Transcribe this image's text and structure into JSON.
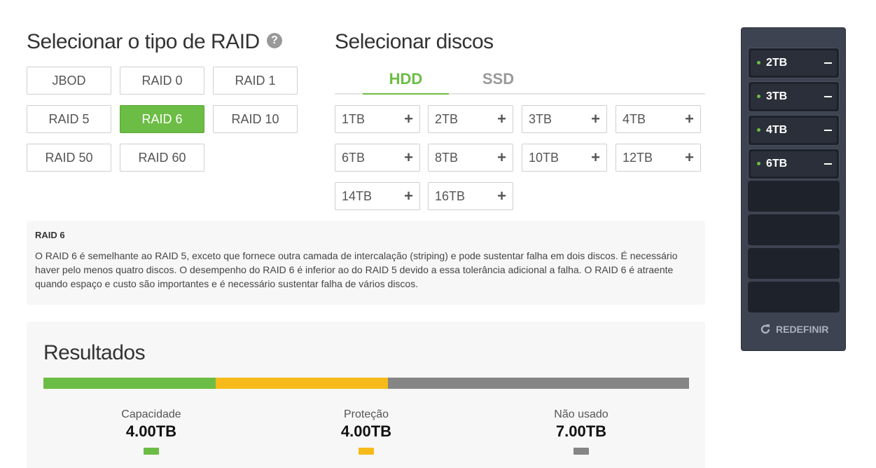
{
  "raid_section": {
    "title": "Selecionar o tipo de RAID",
    "help_glyph": "?",
    "types": [
      {
        "label": "JBOD",
        "active": false
      },
      {
        "label": "RAID 0",
        "active": false
      },
      {
        "label": "RAID 1",
        "active": false
      },
      {
        "label": "RAID 5",
        "active": false
      },
      {
        "label": "RAID 6",
        "active": true
      },
      {
        "label": "RAID 10",
        "active": false
      },
      {
        "label": "RAID 50",
        "active": false
      },
      {
        "label": "RAID 60",
        "active": false
      }
    ]
  },
  "disk_section": {
    "title": "Selecionar discos",
    "tabs": [
      {
        "label": "HDD",
        "active": true
      },
      {
        "label": "SSD",
        "active": false
      }
    ],
    "disks": [
      "1TB",
      "2TB",
      "3TB",
      "4TB",
      "6TB",
      "8TB",
      "10TB",
      "12TB",
      "14TB",
      "16TB"
    ],
    "add_glyph": "+"
  },
  "description": {
    "title": "RAID 6",
    "text": "O RAID 6 é semelhante ao RAID 5, exceto que fornece outra camada de intercalação (striping) e pode sustentar falha em dois discos. É necessário haver pelo menos quatro discos. O desempenho do RAID 6 é inferior ao do RAID 5 devido a essa tolerância adicional a falha. O RAID 6 é atraente quando espaço e custo são importantes e é necessário sustentar falha de vários discos."
  },
  "results": {
    "title": "Resultados",
    "segments": [
      {
        "name": "capacity",
        "fraction": 0.2667,
        "color": "#6cbd45"
      },
      {
        "name": "protection",
        "fraction": 0.2667,
        "color": "#f6bb1a"
      },
      {
        "name": "unused",
        "fraction": 0.4666,
        "color": "#858585"
      }
    ],
    "stats": [
      {
        "label": "Capacidade",
        "value": "4.00TB",
        "color": "#6cbd45"
      },
      {
        "label": "Proteção",
        "value": "4.00TB",
        "color": "#f6bb1a"
      },
      {
        "label": "Não usado",
        "value": "7.00TB",
        "color": "#858585"
      }
    ]
  },
  "enclosure": {
    "slots": [
      "2TB",
      "3TB",
      "4TB",
      "6TB",
      "",
      "",
      "",
      ""
    ],
    "reset_label": "REDEFINIR"
  }
}
